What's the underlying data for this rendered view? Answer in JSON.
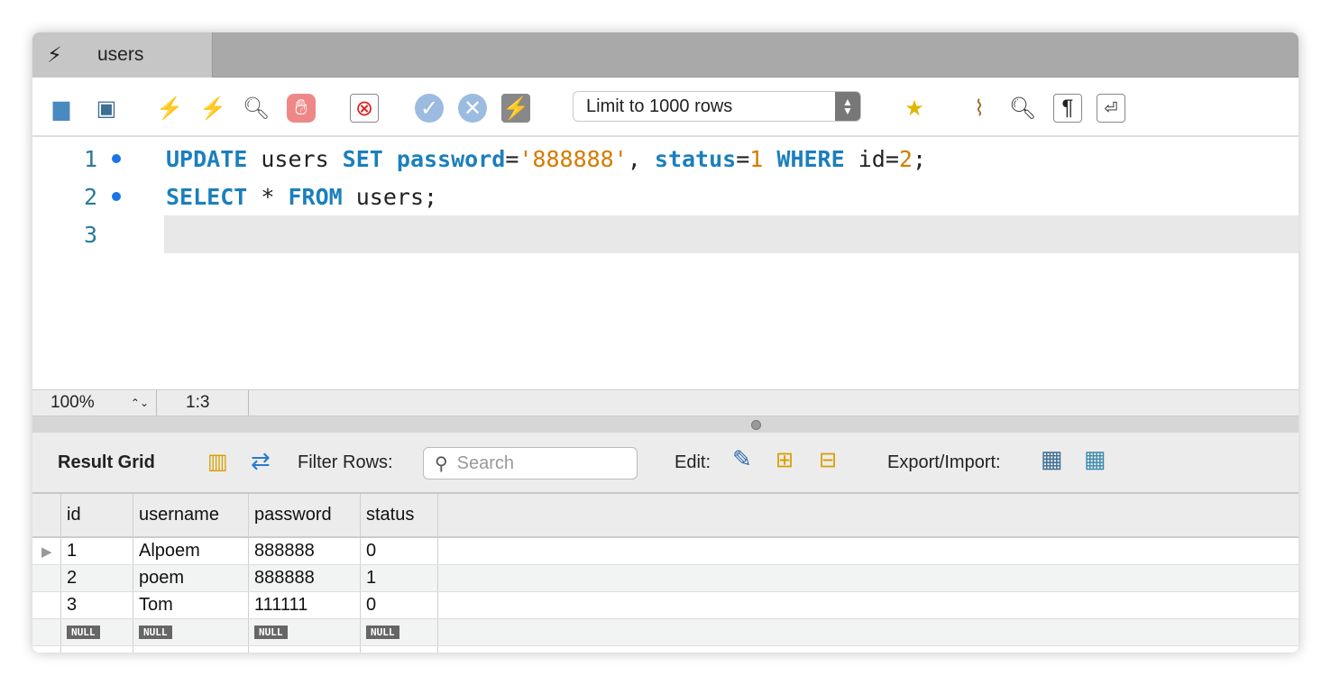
{
  "tab": {
    "title": "users",
    "icon": "lightning-icon"
  },
  "toolbar": {
    "limit_select": "Limit to 1000 rows"
  },
  "editor": {
    "lines": [
      {
        "n": "1",
        "tokens": [
          [
            "kw",
            "UPDATE"
          ],
          [
            "",
            "users "
          ],
          [
            "kw",
            "SET"
          ],
          [
            "",
            ""
          ],
          [
            "kw",
            "password"
          ],
          [
            "",
            "="
          ],
          [
            "str",
            "'888888'"
          ],
          [
            "",
            ", "
          ],
          [
            "kw",
            "status"
          ],
          [
            "",
            "="
          ],
          [
            "num",
            "1"
          ],
          [
            "",
            " "
          ],
          [
            "kw",
            "WHERE"
          ],
          [
            "",
            " id="
          ],
          [
            "num",
            "2"
          ],
          [
            "",
            ";"
          ]
        ]
      },
      {
        "n": "2",
        "tokens": [
          [
            "kw",
            "SELECT"
          ],
          [
            "",
            " * "
          ],
          [
            "kw",
            "FROM"
          ],
          [
            "",
            " users;"
          ]
        ]
      },
      {
        "n": "3",
        "tokens": []
      }
    ]
  },
  "status": {
    "zoom": "100%",
    "position": "1:3"
  },
  "result": {
    "title": "Result Grid",
    "filter_label": "Filter Rows:",
    "search_placeholder": "Search",
    "edit_label": "Edit:",
    "export_label": "Export/Import:"
  },
  "grid": {
    "columns": [
      "id",
      "username",
      "password",
      "status"
    ],
    "rows": [
      [
        "1",
        "Alpoem",
        "888888",
        "0"
      ],
      [
        "2",
        "poem",
        "888888",
        "1"
      ],
      [
        "3",
        "Tom",
        "111111",
        "0"
      ]
    ],
    "null_label": "NULL"
  }
}
